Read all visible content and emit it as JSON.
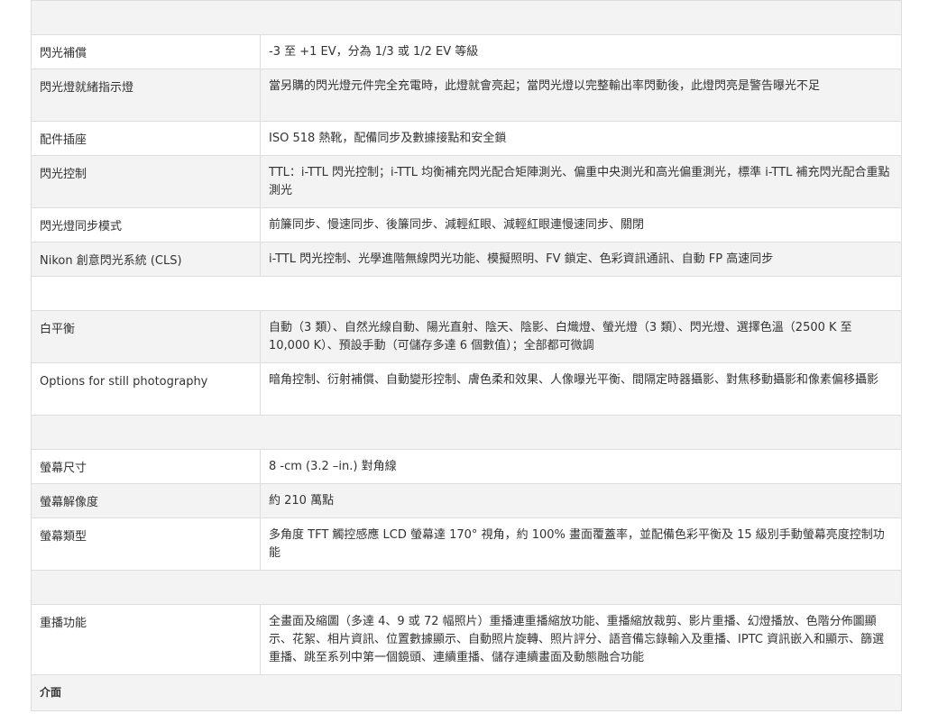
{
  "specs": [
    {
      "type": "section",
      "label": ""
    },
    {
      "type": "row",
      "label": "閃光補償",
      "value": "-3 至 +1 EV，分為 1/3 或 1/2 EV 等級"
    },
    {
      "type": "row",
      "label": "閃光燈就緒指示燈",
      "value": "當另購的閃光燈元件完全充電時，此燈就會亮起；當閃光燈以完整輸出率閃動後，此燈閃亮是警告曝光不足"
    },
    {
      "type": "row",
      "label": "配件插座",
      "value": "ISO 518 熱靴，配備同步及數據接點和安全鎖"
    },
    {
      "type": "row",
      "label": "閃光控制",
      "value": "TTL：i-TTL 閃光控制；i-TTL 均衡補充閃光配合矩陣測光、偏重中央測光和高光偏重測光，標準 i-TTL 補充閃光配合重點測光"
    },
    {
      "type": "row",
      "label": "閃光燈同步模式",
      "value": "前簾同步、慢速同步、後簾同步、減輕紅眼、減輕紅眼連慢速同步、關閉"
    },
    {
      "type": "row",
      "label": "Nikon 創意閃光系統 (CLS)",
      "value": "i-TTL 閃光控制、光學進階無線閃光功能、模擬照明、FV 鎖定、色彩資訊通訊、自動 FP 高速同步"
    },
    {
      "type": "section",
      "label": ""
    },
    {
      "type": "row",
      "label": "白平衡",
      "value": "自動（3 類）、自然光線自動、陽光直射、陰天、陰影、白熾燈、螢光燈（3 類）、閃光燈、選擇色溫（2500 K 至 10,000 K）、預設手動（可儲存多達 6 個數值）；全部都可微調"
    },
    {
      "type": "row",
      "label": "Options for still photography",
      "value": "暗角控制、衍射補償、自動變形控制、膚色柔和效果、人像曝光平衡、間隔定時器攝影、對焦移動攝影和像素偏移攝影"
    },
    {
      "type": "section",
      "label": ""
    },
    {
      "type": "row",
      "label": "螢幕尺寸",
      "value": "8 -cm (3.2 –in.) 對角線"
    },
    {
      "type": "row",
      "label": "螢幕解像度",
      "value": "約 210 萬點"
    },
    {
      "type": "row",
      "label": "螢幕類型",
      "value": "多角度 TFT 觸控感應 LCD 螢幕達 170° 視角，約 100% 畫面覆蓋率，並配備色彩平衡及 15 級別手動螢幕亮度控制功能"
    },
    {
      "type": "section",
      "label": ""
    },
    {
      "type": "row",
      "label": "重播功能",
      "value": "全畫面及縮圖（多達 4、9 或 72 幅照片）重播連重播縮放功能、重播縮放裁剪、影片重播、幻燈播放、色階分佈圖顯示、花絮、相片資訊、位置數據顯示、自動照片旋轉、照片評分、語音備忘錄輸入及重播、IPTC 資訊嵌入和顯示、篩選重播、跳至系列中第一個鏡頭、連續重播、儲存連續畫面及動態融合功能"
    },
    {
      "type": "section",
      "label": "介面"
    }
  ]
}
